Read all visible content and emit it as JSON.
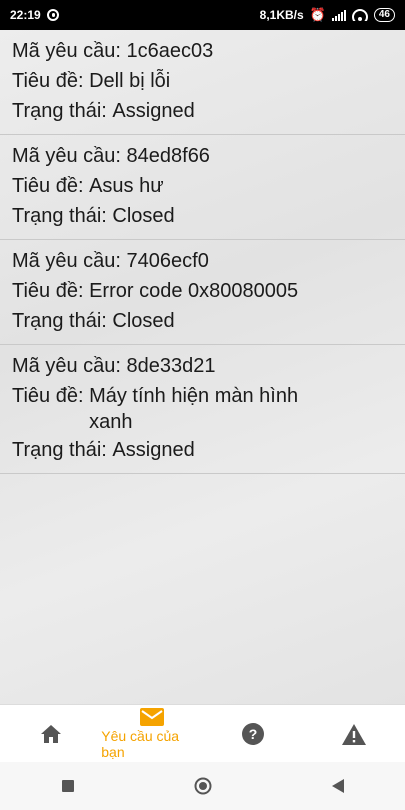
{
  "status_bar": {
    "time": "22:19",
    "network_speed": "8,1KB/s",
    "battery": "46",
    "icons": [
      "pinterest-icon",
      "alarm-icon",
      "signal-icon",
      "wifi-icon",
      "battery-icon"
    ]
  },
  "labels": {
    "id": "Mã yêu cầu: ",
    "title": "Tiêu đề: ",
    "status": "Trạng thái: "
  },
  "requests": [
    {
      "id": "1c6aec03",
      "title": "Dell bị lỗi",
      "status": "Assigned"
    },
    {
      "id": "84ed8f66",
      "title": "Asus hư",
      "status": "Closed"
    },
    {
      "id": "7406ecf0",
      "title": "Error code 0x80080005",
      "status": "Closed"
    },
    {
      "id": "8de33d21",
      "title": "Máy tính hiện màn hình xanh",
      "status": "Assigned"
    }
  ],
  "bottom_nav": {
    "items": [
      {
        "icon": "home-icon",
        "label": ""
      },
      {
        "icon": "mail-icon",
        "label": "Yêu cầu của bạn",
        "active": true
      },
      {
        "icon": "help-icon",
        "label": ""
      },
      {
        "icon": "warning-icon",
        "label": ""
      }
    ],
    "active_color": "#f5a300",
    "icon_color": "#555555"
  },
  "system_nav": {
    "icons": [
      "recents-icon",
      "home-circle-icon",
      "back-icon"
    ]
  }
}
